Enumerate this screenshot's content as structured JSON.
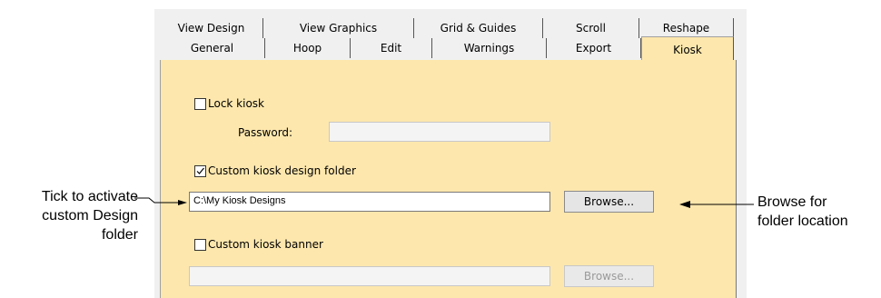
{
  "tabs": {
    "row1": [
      {
        "label": "View Design"
      },
      {
        "label": "View Graphics"
      },
      {
        "label": "Grid & Guides"
      },
      {
        "label": "Scroll"
      },
      {
        "label": "Reshape"
      }
    ],
    "row2": [
      {
        "label": "General"
      },
      {
        "label": "Hoop"
      },
      {
        "label": "Edit"
      },
      {
        "label": "Warnings"
      },
      {
        "label": "Export"
      },
      {
        "label": "Kiosk",
        "active": true
      }
    ]
  },
  "kiosk": {
    "lock_kiosk_label": "Lock kiosk",
    "lock_kiosk_checked": false,
    "password_label": "Password:",
    "password_value": "",
    "custom_folder_label": "Custom kiosk design folder",
    "custom_folder_checked": true,
    "folder_path": "C:\\My Kiosk Designs",
    "browse_label": "Browse...",
    "custom_banner_label": "Custom kiosk banner",
    "custom_banner_checked": false,
    "banner_path": "",
    "browse_banner_label": "Browse..."
  },
  "callouts": {
    "left_line1": "Tick to activate",
    "left_line2": "custom Design",
    "left_line3": "folder",
    "right_line1": "Browse for",
    "right_line2": "folder location"
  },
  "colors": {
    "panel": "#fde7ad",
    "dialog": "#f0f0f0"
  }
}
